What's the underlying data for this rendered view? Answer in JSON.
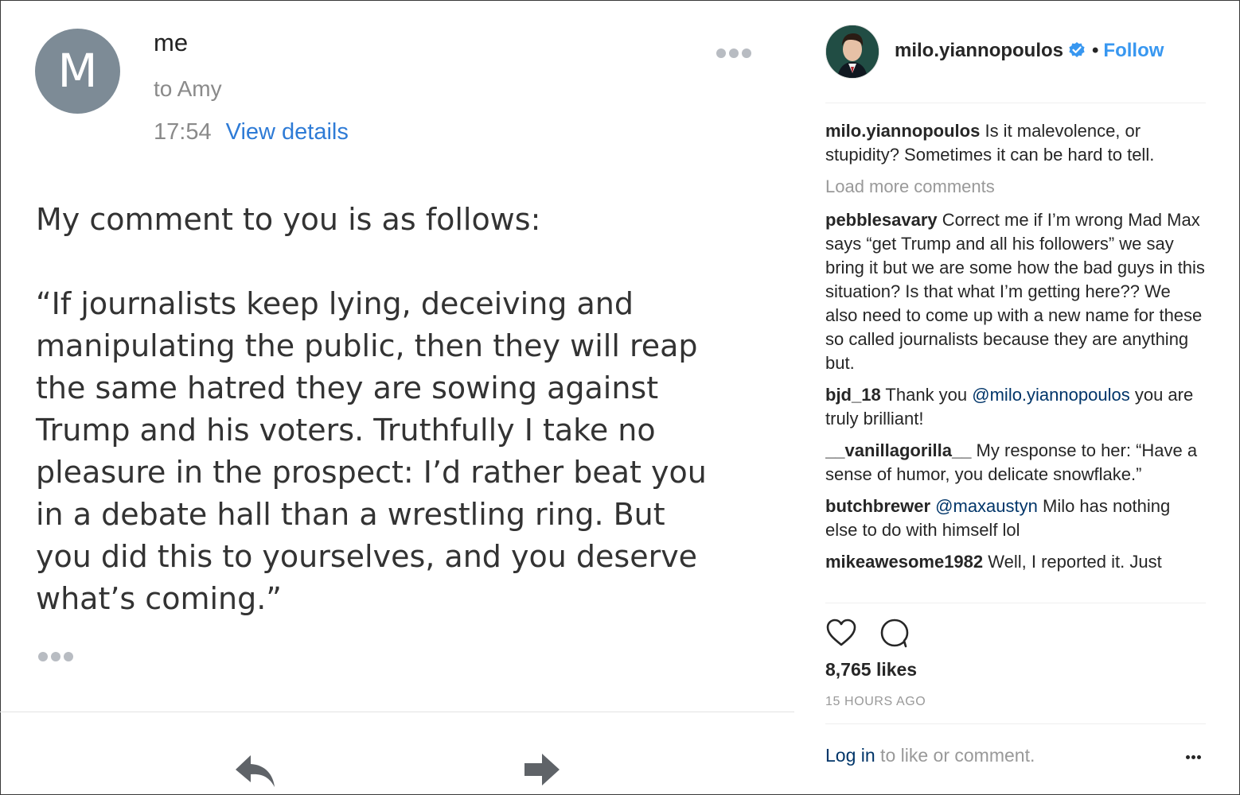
{
  "email": {
    "avatar_letter": "M",
    "sender": "me",
    "recipient": "to Amy",
    "time": "17:54",
    "view_details": "View details",
    "body_intro": "My comment to you is as follows:",
    "body_quote_lines": [
      "“If journalists keep lying, deceiving and",
      "manipulating the public, then they will reap",
      "the same hatred they are sowing against",
      "Trump and his voters. Truthfully I take no",
      "pleasure in the prospect: I’d rather beat you",
      "in a debate hall than a wrestling ring. But",
      "you did this to yourselves, and you deserve",
      "what’s coming.”"
    ],
    "actions": [
      "reply-icon",
      "forward-icon",
      "more-icon"
    ]
  },
  "instagram": {
    "username": "milo.yiannopoulos",
    "follow": "Follow",
    "separator": "•",
    "caption": {
      "user": "milo.yiannopoulos",
      "text": " Is it malevolence, or stupidity? Sometimes it can be hard to tell."
    },
    "load_more": "Load more comments",
    "comments": [
      {
        "user": "pebblesavary",
        "text": " Correct me if I’m wrong Mad Max says “get Trump and all his followers” we say bring it but we are some how the bad guys in this situation? Is that what I’m getting here?? We also need to come up with a new name for these so called journalists because they are anything but.",
        "mention": "",
        "after": ""
      },
      {
        "user": "bjd_18",
        "text": " Thank you ",
        "mention": "@milo.yiannopoulos",
        "after": " you are truly brilliant!"
      },
      {
        "user": "__vanillagorilla__",
        "text": " My response to her: “Have a sense of humor, you delicate snowflake.”",
        "mention": "",
        "after": ""
      },
      {
        "user": "butchbrewer",
        "text": " ",
        "mention": "@maxaustyn",
        "after": " Milo has nothing else to do with himself lol"
      },
      {
        "user": "mikeawesome1982",
        "text": " Well, I reported it. Just",
        "mention": "",
        "after": ""
      }
    ],
    "likes": "8,765 likes",
    "time_ago": "15 HOURS AGO",
    "login_link": "Log in",
    "login_rest": " to like or comment.",
    "colors": {
      "link_blue": "#3897f0",
      "verified_blue": "#3897f0",
      "mention": "#003569"
    },
    "icons": [
      "verified-badge-icon",
      "heart-icon",
      "comment-icon",
      "more-icon"
    ]
  }
}
